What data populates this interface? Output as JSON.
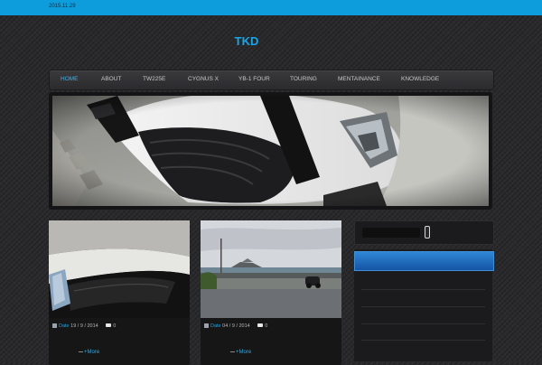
{
  "header": {
    "date": "2015.11.29",
    "site_title": "TKD"
  },
  "nav": {
    "items": [
      {
        "label": "HOME",
        "active": true
      },
      {
        "label": "ABOUT",
        "active": false
      },
      {
        "label": "TW225E",
        "active": false
      },
      {
        "label": "CYGNUS X",
        "active": false
      },
      {
        "label": "YB-1 FOUR",
        "active": false
      },
      {
        "label": "TOURING",
        "active": false
      },
      {
        "label": "MENTAINANCE",
        "active": false
      },
      {
        "label": "KNOWLEDGE",
        "active": false
      }
    ]
  },
  "posts": [
    {
      "date_label": "Date",
      "date": "19 / 9 / 2014",
      "comments": "0",
      "more": "+More"
    },
    {
      "date_label": "Date",
      "date": "04 / 9 / 2014",
      "comments": "0",
      "more": "+More"
    }
  ],
  "colors": {
    "accent": "#1ba4e6",
    "topbar": "#0e9ddc",
    "widget_header": "#2f86d6"
  }
}
